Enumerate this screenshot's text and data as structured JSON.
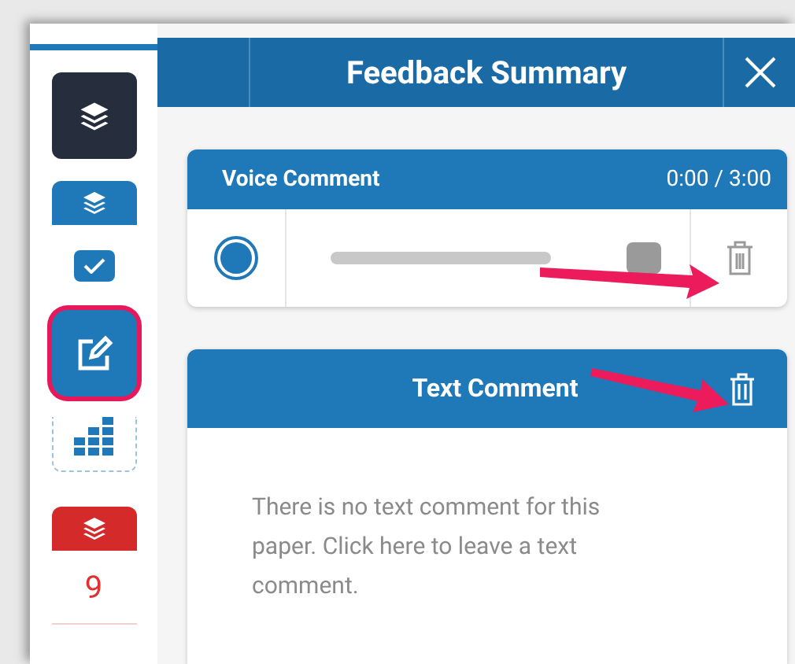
{
  "sidebar": {
    "items": [
      {
        "kind": "layers-dark",
        "selected": false
      },
      {
        "kind": "layers-tab",
        "selected": false
      },
      {
        "kind": "checkbox",
        "selected": false
      },
      {
        "kind": "edit",
        "selected": true
      },
      {
        "kind": "grid",
        "selected": false
      },
      {
        "kind": "layers-red",
        "selected": false
      },
      {
        "kind": "count",
        "text": "9",
        "selected": false
      }
    ]
  },
  "header": {
    "title": "Feedback Summary"
  },
  "voice_comment": {
    "title": "Voice Comment",
    "time": "0:00 / 3:00"
  },
  "text_comment": {
    "title": "Text Comment",
    "message": "There is no text comment for this paper. Click here to leave a text comment."
  }
}
